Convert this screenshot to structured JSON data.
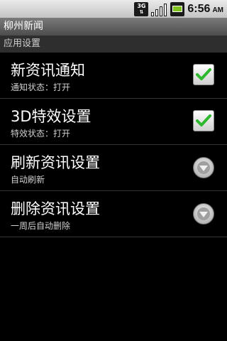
{
  "status_bar": {
    "network_label": "3G",
    "time": "6:56",
    "ampm": "AM",
    "icons": [
      "network-3g-icon",
      "signal-strength-icon",
      "battery-icon"
    ]
  },
  "app": {
    "title": "柳州新闻"
  },
  "section": {
    "title": "应用设置"
  },
  "preferences": [
    {
      "title": "新资讯通知",
      "summary": "通知状态：打开",
      "control": "checkbox",
      "checked": true
    },
    {
      "title": "3D特效设置",
      "summary": "特效状态：打开",
      "control": "checkbox",
      "checked": true
    },
    {
      "title": "刷新资讯设置",
      "summary": "自动刷新",
      "control": "dropdown"
    },
    {
      "title": "删除资讯设置",
      "summary": "一周后自动删除",
      "control": "dropdown"
    }
  ],
  "colors": {
    "background": "#000000",
    "checkmark": "#2eb82e",
    "divider": "#333333",
    "title_bar": "#5e5e5e"
  }
}
